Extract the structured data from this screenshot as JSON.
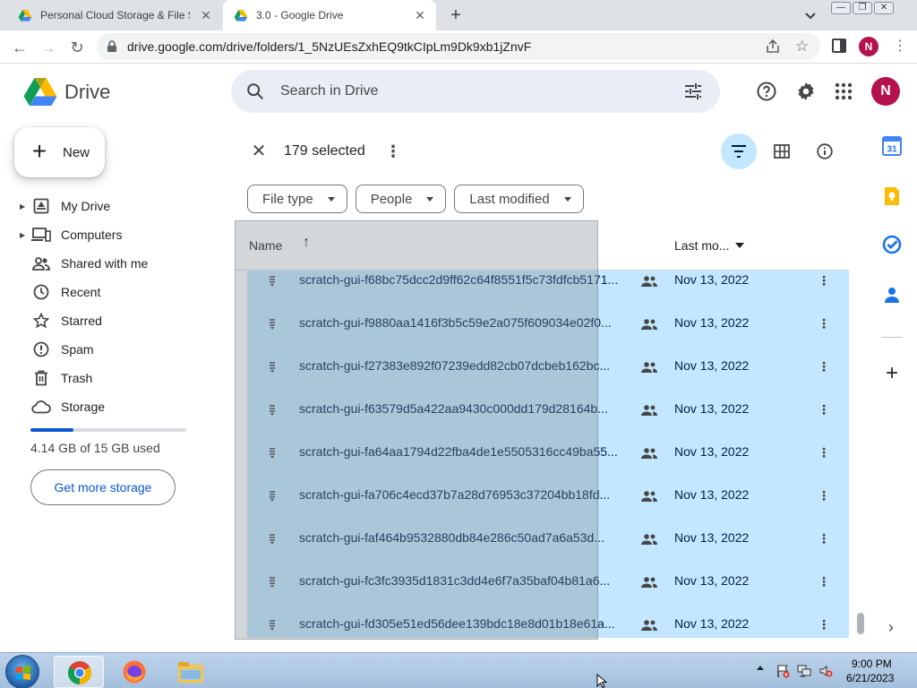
{
  "browser": {
    "tabs": [
      {
        "title": "Personal Cloud Storage & File Sh",
        "active": false
      },
      {
        "title": "3.0 - Google Drive",
        "active": true
      }
    ],
    "url": "drive.google.com/drive/folders/1_5NzUEsZxhEQ9tkCIpLm9Dk9xb1jZnvF",
    "profile_initial": "N"
  },
  "drive": {
    "brand": "Drive",
    "search_placeholder": "Search in Drive",
    "avatar_initial": "N",
    "new_label": "New",
    "nav": [
      {
        "label": "My Drive",
        "icon": "my-drive-icon",
        "expandable": true
      },
      {
        "label": "Computers",
        "icon": "computers-icon",
        "expandable": true
      },
      {
        "label": "Shared with me",
        "icon": "shared-icon",
        "expandable": false
      },
      {
        "label": "Recent",
        "icon": "clock-icon",
        "expandable": false
      },
      {
        "label": "Starred",
        "icon": "star-icon",
        "expandable": false
      },
      {
        "label": "Spam",
        "icon": "spam-icon",
        "expandable": false
      },
      {
        "label": "Trash",
        "icon": "trash-icon",
        "expandable": false
      },
      {
        "label": "Storage",
        "icon": "cloud-icon",
        "expandable": false
      }
    ],
    "storage": {
      "used_text": "4.14 GB of 15 GB used",
      "fraction": 0.276,
      "cta": "Get more storage"
    },
    "selection": {
      "count_text": "179 selected"
    },
    "filters": [
      "File type",
      "People",
      "Last modified"
    ],
    "columns": {
      "name": "Name",
      "modified": "Last mo..."
    },
    "files": [
      {
        "name": "scratch-gui-f68bc75dcc2d9ff62c64f8551f5c73fdfcb5171...",
        "modified": "Nov 13, 2022"
      },
      {
        "name": "scratch-gui-f9880aa1416f3b5c59e2a075f609034e02f0...",
        "modified": "Nov 13, 2022"
      },
      {
        "name": "scratch-gui-f27383e892f07239edd82cb07dcbeb162bc...",
        "modified": "Nov 13, 2022"
      },
      {
        "name": "scratch-gui-f63579d5a422aa9430c000dd179d28164b...",
        "modified": "Nov 13, 2022"
      },
      {
        "name": "scratch-gui-fa64aa1794d22fba4de1e5505316cc49ba55...",
        "modified": "Nov 13, 2022"
      },
      {
        "name": "scratch-gui-fa706c4ecd37b7a28d76953c37204bb18fd...",
        "modified": "Nov 13, 2022"
      },
      {
        "name": "scratch-gui-faf464b9532880db84e286c50ad7a6a53d...",
        "modified": "Nov 13, 2022"
      },
      {
        "name": "scratch-gui-fc3fc3935d1831c3dd4e6f7a35baf04b81a6...",
        "modified": "Nov 13, 2022"
      },
      {
        "name": "scratch-gui-fd305e51ed56dee139bdc18e8d01b18e61a...",
        "modified": "Nov 13, 2022"
      }
    ],
    "side_panel": [
      "calendar-icon",
      "keep-icon",
      "tasks-icon",
      "contacts-icon"
    ],
    "calendar_day": "31"
  },
  "taskbar": {
    "apps": [
      "chrome-icon",
      "firefox-icon",
      "explorer-icon"
    ],
    "time": "9:00 PM",
    "date": "6/21/2023"
  },
  "colors": {
    "selection": "#c2e7ff",
    "accent": "#0b57d0",
    "avatar": "#b3124e"
  }
}
